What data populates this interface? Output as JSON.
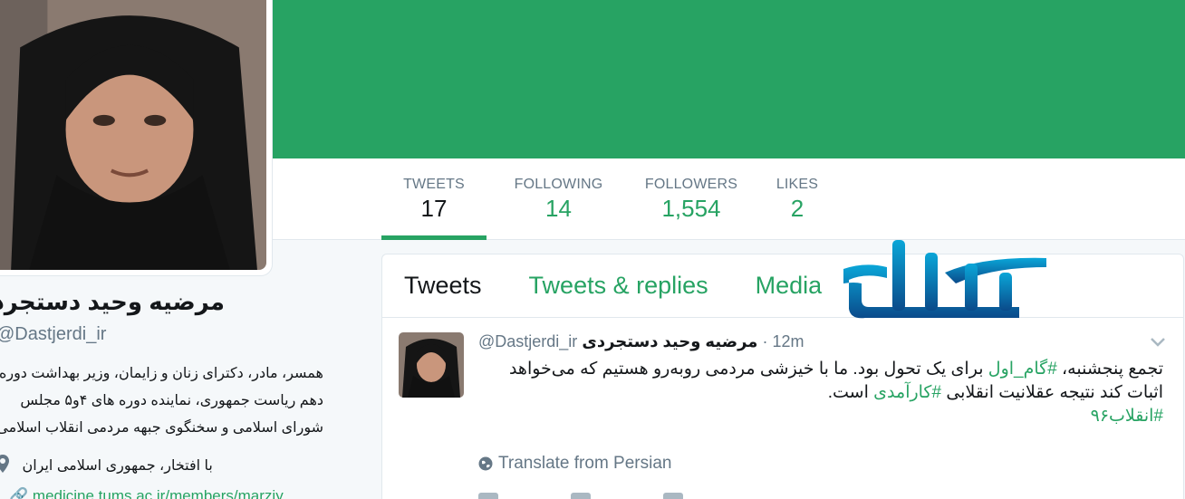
{
  "colors": {
    "accent": "#27a363",
    "banner": "#27a363",
    "text": "#14171a",
    "muted": "#657786"
  },
  "stats": [
    {
      "label": "TWEETS",
      "value": "17"
    },
    {
      "label": "FOLLOWING",
      "value": "14"
    },
    {
      "label": "FOLLOWERS",
      "value": "1,554"
    },
    {
      "label": "LIKES",
      "value": "2"
    }
  ],
  "profile": {
    "name": "مرضیه وحید دستجردی",
    "handle": "@Dastjerdi_ir",
    "bio": [
      "همسر، مادر، دکترای زنان و زایمان، وزیر بهداشت دوره",
      "دهم ریاست جمهوری، نماینده دوره های ۴و۵ مجلس",
      "شورای اسلامی و سخنگوی جبهه مردمی انقلاب اسلامی"
    ],
    "location": "با افتخار، جمهوری اسلامی ایران",
    "location_icon": "location-pin-icon",
    "link": "medicine.tums.ac.ir/members/marziy..."
  },
  "tabs": [
    {
      "label": "Tweets"
    },
    {
      "label": "Tweets & replies"
    },
    {
      "label": "Media"
    }
  ],
  "tweet": {
    "name": "مرضیه وحید دستجردی",
    "handle": "@Dastjerdi_ir",
    "time": "12m",
    "line1_pre": "تجمع پنجشنبه، ",
    "hashtag1": "#گام_اول",
    "line1_post": " برای یک تحول بود. ما با خیزشی مردمی روبه‌رو هستیم که می‌خواهد",
    "line2_pre": "اثبات کند نتیجه عقلانیت انقلابی ",
    "hashtag2": "#کارآمدی",
    "line2_post": " است.",
    "hashtag3": "#انقلاب۹۶",
    "translate": "Translate from Persian"
  }
}
